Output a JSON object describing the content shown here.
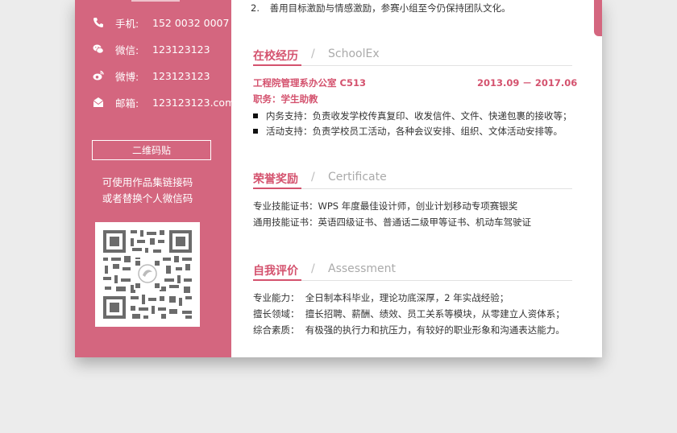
{
  "sidebar": {
    "contacts": [
      {
        "icon": "phone-icon",
        "label": "手机:",
        "value": "152 0032 0007"
      },
      {
        "icon": "wechat-icon",
        "label": "微信:",
        "value": "123123123"
      },
      {
        "icon": "weibo-icon",
        "label": "微博:",
        "value": "123123123"
      },
      {
        "icon": "mail-icon",
        "label": "邮箱:",
        "value": "123123123.com"
      }
    ],
    "qr_button_label": "二维码贴",
    "qr_note": [
      "可使用作品集链接码",
      "或者替换个人微信码"
    ]
  },
  "main": {
    "top_item": {
      "num": "2.",
      "text": "善用目标激励与情感激励，参赛小组至今仍保持团队文化。"
    },
    "school": {
      "title_cn": "在校经历",
      "slash": "/",
      "title_en": "SchoolEx",
      "org": "工程院管理系办公室 C513",
      "period": "2013.09 － 2017.06",
      "position": "职务：学生助教",
      "bullets": [
        "内务支持：负责收发学校传真复印、收发信件、文件、快递包裹的接收等；",
        "活动支持：负责学校员工活动，各种会议安排、组织、文体活动安排等。"
      ]
    },
    "honor": {
      "title_cn": "荣誉奖励",
      "slash": "/",
      "title_en": "Certificate",
      "lines": [
        "专业技能证书：WPS 年度最佳设计师，创业计划移动专项赛银奖",
        "通用技能证书：英语四级证书、普通话二级甲等证书、机动车驾驶证"
      ]
    },
    "self": {
      "title_cn": "自我评价",
      "slash": "/",
      "title_en": "Assessment",
      "lines": [
        "专业能力：  全日制本科毕业，理论功底深厚，2 年实战经验；",
        "擅长领域：  擅长招聘、薪酬、绩效、员工关系等模块，从零建立人资体系；",
        "综合素质：  有极强的执行力和抗压力，有较好的职业形象和沟通表达能力。"
      ]
    }
  },
  "colors": {
    "accent": "#d4526e",
    "sidebar": "#d4667f",
    "background": "#ececec"
  }
}
